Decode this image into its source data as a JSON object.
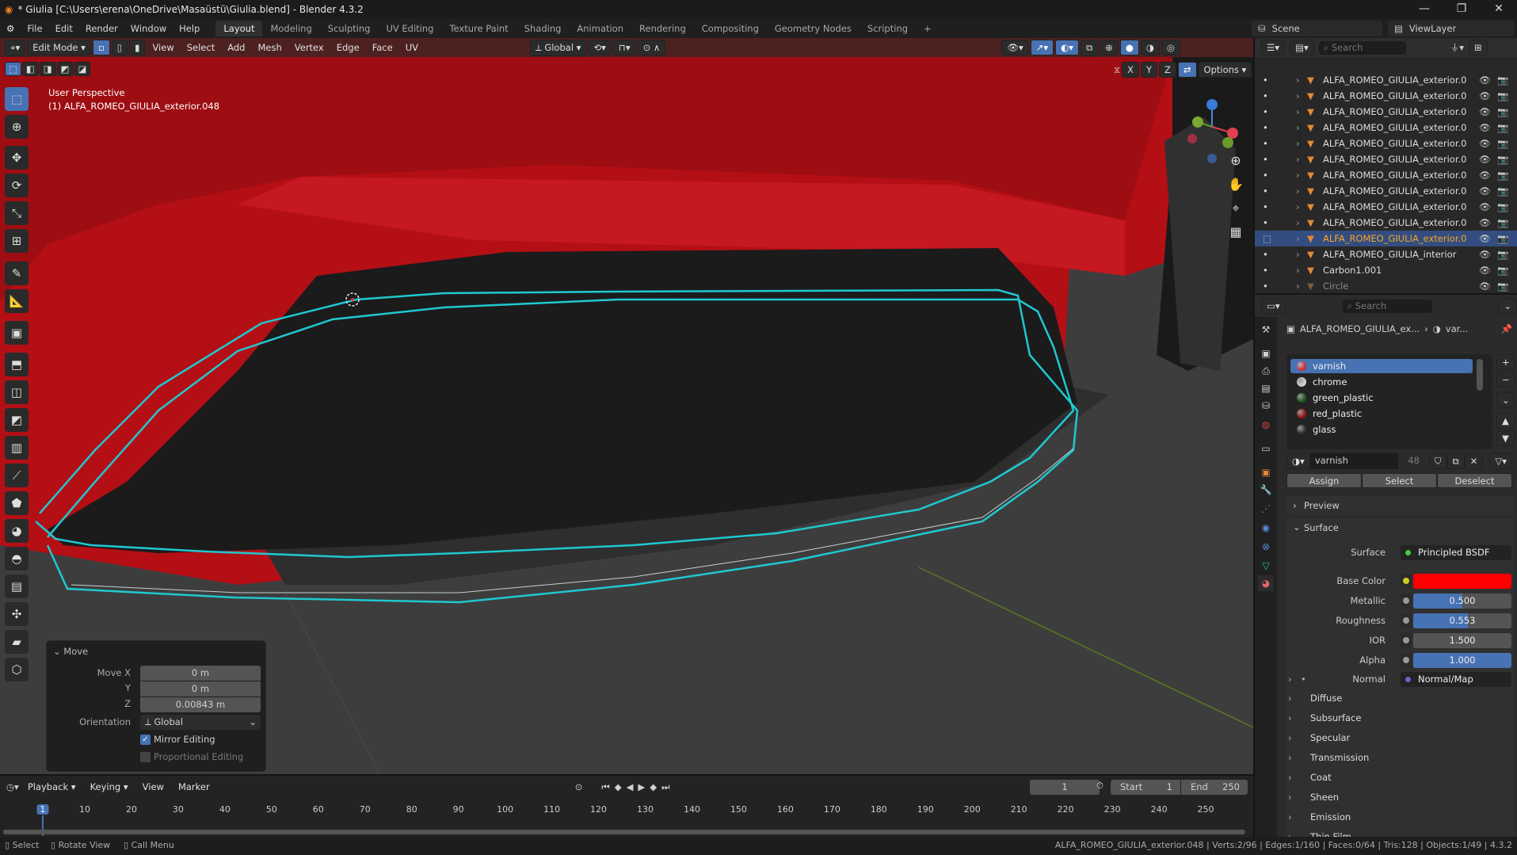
{
  "window": {
    "title": "* Giulia [C:\\Users\\erena\\OneDrive\\Masaüstü\\Giulia.blend] - Blender 4.3.2",
    "minimize": "—",
    "maximize": "❐",
    "close": "✕"
  },
  "menu": [
    "File",
    "Edit",
    "Render",
    "Window",
    "Help"
  ],
  "workspaces": [
    "Layout",
    "Modeling",
    "Sculpting",
    "UV Editing",
    "Texture Paint",
    "Shading",
    "Animation",
    "Rendering",
    "Compositing",
    "Geometry Nodes",
    "Scripting",
    "+"
  ],
  "scene": {
    "scene": "Scene",
    "view_layer": "ViewLayer"
  },
  "viewport": {
    "mode": "Edit Mode",
    "menus": [
      "View",
      "Select",
      "Add",
      "Mesh",
      "Vertex",
      "Edge",
      "Face",
      "UV"
    ],
    "orientation": "Global",
    "overlay_label": "User Perspective",
    "object_label": "(1) ALFA_ROMEO_GIULIA_exterior.048",
    "axes": [
      "X",
      "Y",
      "Z"
    ],
    "options": "Options"
  },
  "operator_panel": {
    "title": "Move",
    "fields": [
      {
        "label": "Move X",
        "value": "0 m"
      },
      {
        "label": "Y",
        "value": "0 m"
      },
      {
        "label": "Z",
        "value": "0.00843 m"
      }
    ],
    "orientation_label": "Orientation",
    "orientation": "Global",
    "mirror": "Mirror Editing",
    "mirror_checked": true,
    "proportional": "Proportional Editing",
    "proportional_checked": false
  },
  "outliner": {
    "search": "Search",
    "items": [
      {
        "name": "ALFA_ROMEO_GIULIA_exterior.0"
      },
      {
        "name": "ALFA_ROMEO_GIULIA_exterior.0"
      },
      {
        "name": "ALFA_ROMEO_GIULIA_exterior.0"
      },
      {
        "name": "ALFA_ROMEO_GIULIA_exterior.0"
      },
      {
        "name": "ALFA_ROMEO_GIULIA_exterior.0"
      },
      {
        "name": "ALFA_ROMEO_GIULIA_exterior.0"
      },
      {
        "name": "ALFA_ROMEO_GIULIA_exterior.0"
      },
      {
        "name": "ALFA_ROMEO_GIULIA_exterior.0"
      },
      {
        "name": "ALFA_ROMEO_GIULIA_exterior.0"
      },
      {
        "name": "ALFA_ROMEO_GIULIA_exterior.0"
      },
      {
        "name": "ALFA_ROMEO_GIULIA_exterior.0",
        "selected": true
      },
      {
        "name": "ALFA_ROMEO_GIULIA_interior"
      },
      {
        "name": "Carbon1.001"
      },
      {
        "name": "Circle"
      }
    ]
  },
  "properties": {
    "search": "Search",
    "breadcrumb_object": "ALFA_ROMEO_GIULIA_ex...",
    "breadcrumb_material": "var...",
    "materials": [
      {
        "name": "varnish",
        "color": "#d42a2a"
      },
      {
        "name": "chrome",
        "color": "#cfcfcf"
      },
      {
        "name": "green_plastic",
        "color": "#1e5a1e"
      },
      {
        "name": "red_plastic",
        "color": "#9a1515"
      },
      {
        "name": "glass",
        "color": "#333333"
      }
    ],
    "active_material": "varnish",
    "users": "48",
    "assign": "Assign",
    "select": "Select",
    "deselect": "Deselect",
    "preview": "Preview",
    "surface_panel": "Surface",
    "surface_label": "Surface",
    "surface_value": "Principled BSDF",
    "inputs": [
      {
        "label": "Base Color",
        "color": "#ff0000"
      },
      {
        "label": "Metallic",
        "value": "0.500",
        "fraction": 0.5
      },
      {
        "label": "Roughness",
        "value": "0.553",
        "fraction": 0.553
      },
      {
        "label": "IOR",
        "value": "1.500",
        "fraction": 0
      },
      {
        "label": "Alpha",
        "value": "1.000",
        "fraction": 1
      }
    ],
    "normal_label": "Normal",
    "normal_value": "Normal/Map",
    "subpanels": [
      "Diffuse",
      "Subsurface",
      "Specular",
      "Transmission",
      "Coat",
      "Sheen",
      "Emission",
      "Thin Film"
    ]
  },
  "timeline": {
    "menus": [
      "Playback",
      "Keying",
      "View",
      "Marker"
    ],
    "current_frame": "1",
    "start_label": "Start",
    "start": "1",
    "end_label": "End",
    "end": "250",
    "ticks": [
      "1",
      "10",
      "20",
      "30",
      "40",
      "50",
      "60",
      "70",
      "80",
      "90",
      "100",
      "110",
      "120",
      "130",
      "140",
      "150",
      "160",
      "170",
      "180",
      "190",
      "200",
      "210",
      "220",
      "230",
      "240",
      "250"
    ]
  },
  "statusbar": {
    "hints": [
      "Select",
      "Rotate View",
      "Call Menu"
    ],
    "stats": "ALFA_ROMEO_GIULIA_exterior.048 | Verts:2/96 | Edges:1/160 | Faces:0/64 | Tris:128 | Objects:1/49 | 4.3.2"
  }
}
